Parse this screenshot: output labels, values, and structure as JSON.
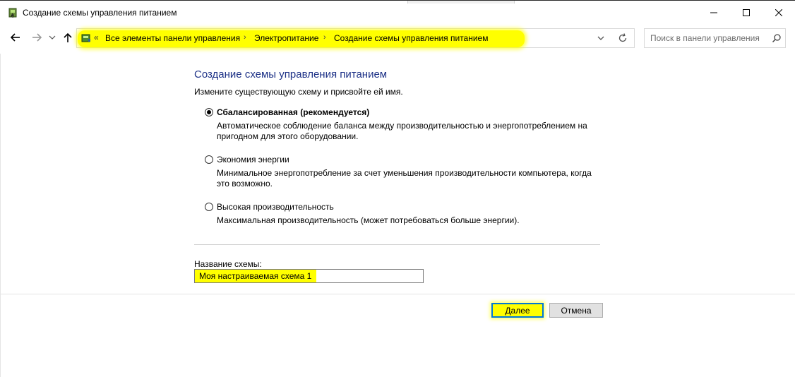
{
  "window": {
    "title": "Создание схемы управления питанием",
    "controls": {
      "minimize": "—",
      "maximize": "☐",
      "close": "✕"
    }
  },
  "nav": {
    "breadcrumb_prefix": "«",
    "breadcrumbs": [
      "Все элементы панели управления",
      "Электропитание",
      "Создание схемы управления питанием"
    ],
    "breadcrumb_separator": "›",
    "search_placeholder": "Поиск в панели управления"
  },
  "main": {
    "title": "Создание схемы управления питанием",
    "subtitle": "Измените существующую схему и присвойте ей имя.",
    "options": [
      {
        "label": "Сбалансированная (рекомендуется)",
        "description": "Автоматическое соблюдение баланса между производительностью и энергопотреблением на пригодном для этого оборудовании.",
        "selected": true
      },
      {
        "label": "Экономия энергии",
        "description": "Минимальное энергопотребление за счет уменьшения производительности компьютера, когда это возможно.",
        "selected": false
      },
      {
        "label": "Высокая производительность",
        "description": "Максимальная производительность (может потребоваться больше энергии).",
        "selected": false
      }
    ],
    "plan_name_label": "Название схемы:",
    "plan_name_value": "Моя настраиваемая схема 1"
  },
  "buttons": {
    "next": "Далее",
    "cancel": "Отмена"
  },
  "colors": {
    "title_blue": "#1e3287",
    "highlight": "#ffff00",
    "focus_border": "#0078d7"
  }
}
